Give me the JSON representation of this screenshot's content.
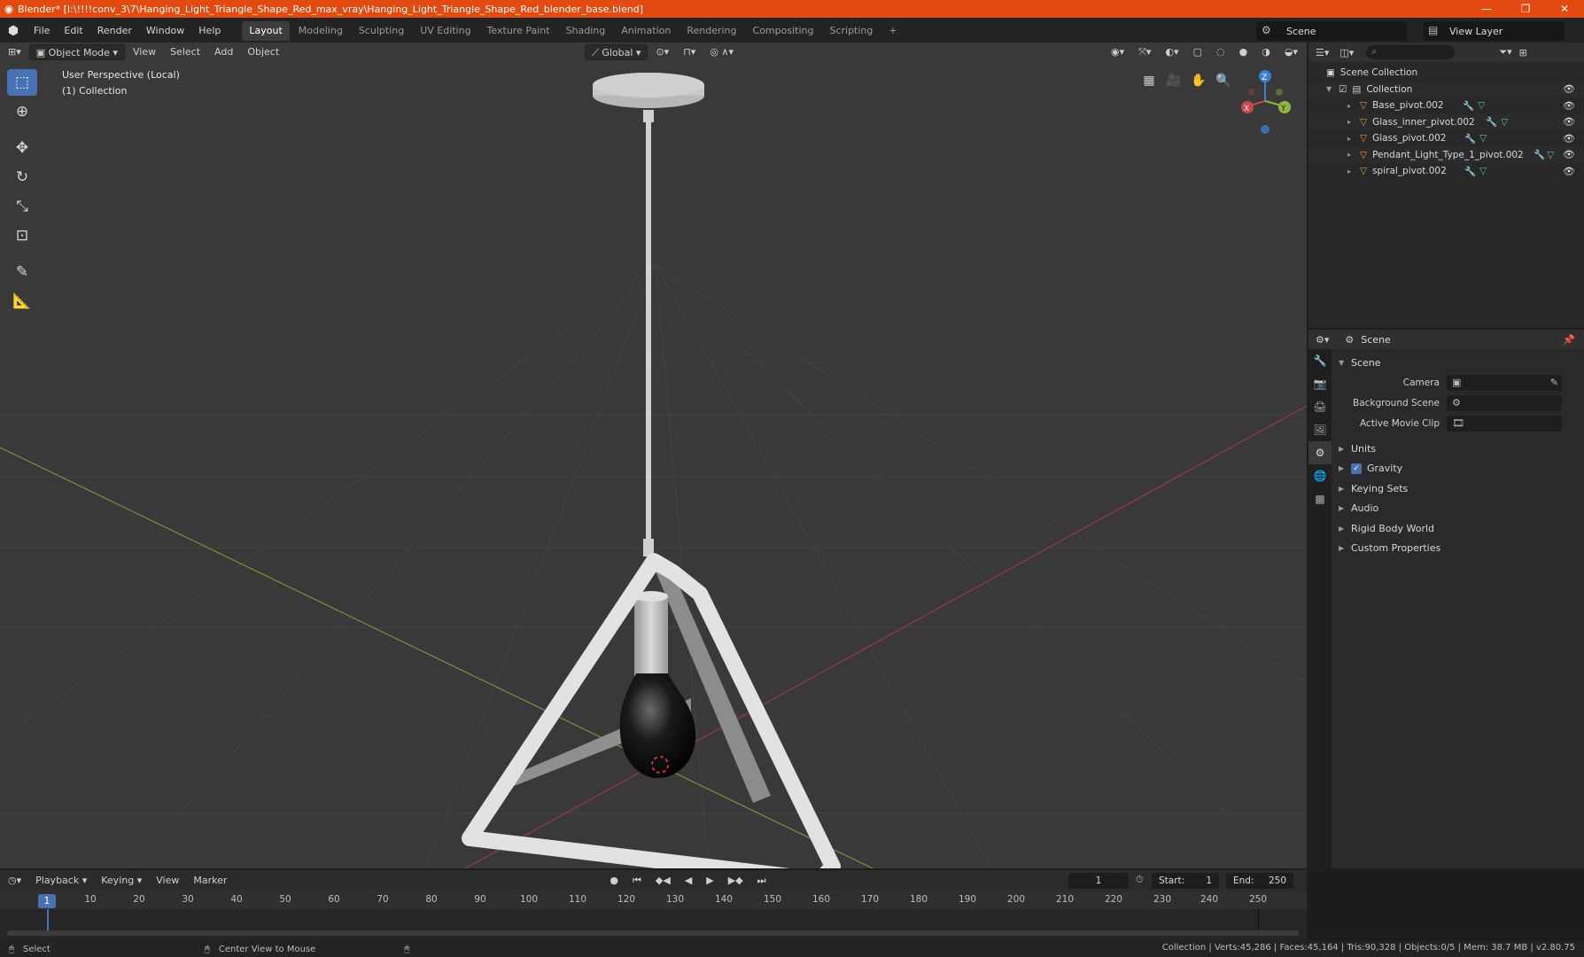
{
  "window": {
    "title": "Blender* [I:\\!!!!conv_3\\7\\Hanging_Light_Triangle_Shape_Red_max_vray\\Hanging_Light_Triangle_Shape_Red_blender_base.blend]",
    "minimize": "—",
    "maximize": "❐",
    "close": "✕"
  },
  "menubar": {
    "items": [
      "File",
      "Edit",
      "Render",
      "Window",
      "Help"
    ],
    "workspaces": [
      "Layout",
      "Modeling",
      "Sculpting",
      "UV Editing",
      "Texture Paint",
      "Shading",
      "Animation",
      "Rendering",
      "Compositing",
      "Scripting"
    ],
    "active_workspace": "Layout",
    "add_tab": "+",
    "scene": "Scene",
    "view_layer": "View Layer"
  },
  "viewport": {
    "mode": "Object Mode",
    "menus": [
      "View",
      "Select",
      "Add",
      "Object"
    ],
    "transform_orientation": "Global",
    "info_line1": "User Perspective (Local)",
    "info_line2": "(1) Collection",
    "gizmo": {
      "x": "X",
      "y": "Y",
      "z": "Z"
    },
    "colors": {
      "background": "#393939",
      "x_axis": "#c8444e",
      "y_axis": "#8fb63a",
      "z_axis": "#3a7fd6"
    },
    "tools": [
      "select-box",
      "cursor",
      "move",
      "rotate",
      "scale",
      "transform",
      "annotate",
      "measure"
    ]
  },
  "outliner": {
    "root": "Scene Collection",
    "collection": "Collection",
    "objects": [
      {
        "name": "Base_pivot.002"
      },
      {
        "name": "Glass_inner_pivot.002"
      },
      {
        "name": "Glass_pivot.002"
      },
      {
        "name": "Pendant_Light_Type_1_pivot.002"
      },
      {
        "name": "spiral_pivot.002"
      }
    ]
  },
  "properties": {
    "context": "Scene",
    "panel": "Scene",
    "fields": [
      {
        "label": "Camera",
        "value": ""
      },
      {
        "label": "Background Scene",
        "value": ""
      },
      {
        "label": "Active Movie Clip",
        "value": ""
      }
    ],
    "subpanels": [
      "Units",
      "Gravity",
      "Keying Sets",
      "Audio",
      "Rigid Body World",
      "Custom Properties"
    ],
    "gravity_checked": true
  },
  "timeline": {
    "menus": [
      "Playback",
      "Keying",
      "View",
      "Marker"
    ],
    "current_frame": "1",
    "start_label": "Start:",
    "start": "1",
    "end_label": "End:",
    "end": "250",
    "ruler": [
      "1",
      "10",
      "20",
      "30",
      "40",
      "50",
      "60",
      "70",
      "80",
      "90",
      "100",
      "110",
      "120",
      "130",
      "140",
      "150",
      "160",
      "170",
      "180",
      "190",
      "200",
      "210",
      "220",
      "230",
      "240",
      "250"
    ]
  },
  "statusbar": {
    "left_action": "Select",
    "middle_action": "Center View to Mouse",
    "stats": "Collection | Verts:45,286 | Faces:45,164 | Tris:90,328 | Objects:0/5 | Mem: 38.7 MB | v2.80.75"
  }
}
